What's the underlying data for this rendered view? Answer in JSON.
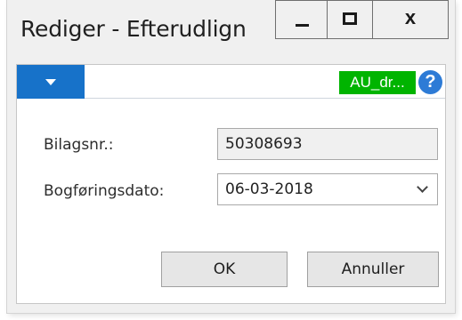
{
  "window": {
    "title": "Rediger - Efterudlign",
    "minimize_glyph": "—",
    "maximize_glyph": "□",
    "close_glyph": "x"
  },
  "actionbar": {
    "company_badge": "AU_dr...",
    "help_glyph": "?",
    "accent_color": "#1772c9",
    "badge_color": "#00b400"
  },
  "form": {
    "bilagsnr_label": "Bilagsnr.:",
    "bilagsnr_value": "50308693",
    "dato_label": "Bogføringsdato:",
    "dato_value": "06-03-2018"
  },
  "buttons": {
    "ok": "OK",
    "cancel": "Annuller"
  }
}
